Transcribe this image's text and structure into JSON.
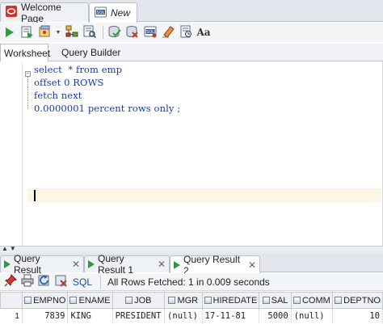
{
  "doc_tabs": [
    {
      "label": "Welcome Page",
      "icon": "oracle-icon",
      "active": false
    },
    {
      "label": "New",
      "icon": "sql-file-icon",
      "active": true
    }
  ],
  "toolbar": {
    "buttons": [
      "run-statement-icon",
      "run-script-icon",
      "autotrace-icon",
      "explain-plan-icon",
      "sql-tuning-icon",
      "commit-icon",
      "rollback-icon",
      "unshared-sql-icon",
      "clear-icon",
      "history-icon",
      "format-case-icon"
    ],
    "format_case_label": "Aa"
  },
  "worksheet_tabs": [
    {
      "label": "Worksheet",
      "active": true
    },
    {
      "label": "Query Builder",
      "active": false
    }
  ],
  "editor": {
    "lines": [
      "select  * from emp",
      "offset 0 ROWS",
      "fetch next",
      "0.0000001 percent rows only ;"
    ],
    "fold_symbol": "−"
  },
  "result_tabs": [
    {
      "label": "Query Result",
      "active": false
    },
    {
      "label": "Query Result 1",
      "active": false
    },
    {
      "label": "Query Result 2",
      "active": true
    }
  ],
  "result_toolbar": {
    "sql_label": "SQL",
    "status": "All Rows Fetched: 1 in 0.009 seconds"
  },
  "grid": {
    "columns": [
      "EMPNO",
      "ENAME",
      "JOB",
      "MGR",
      "HIREDATE",
      "SAL",
      "COMM",
      "DEPTNO"
    ],
    "rows": [
      {
        "rownum": "1",
        "cells": [
          "7839",
          "KING",
          "PRESIDENT",
          "(null)",
          "17-11-81",
          "5000",
          "(null)",
          "10"
        ]
      }
    ]
  },
  "colors": {
    "code_text": "#1a3a9e",
    "run_green": "#2e9b3a",
    "current_line": "#fbf7e4"
  }
}
